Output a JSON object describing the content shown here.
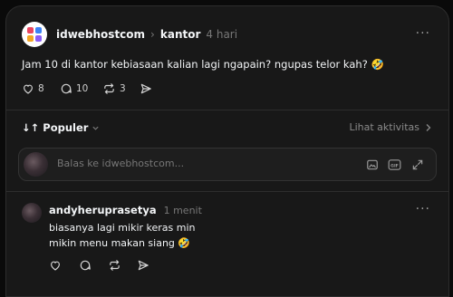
{
  "post": {
    "username": "idwebhostcom",
    "separator": "›",
    "community": "kantor",
    "time": "4 hari",
    "text": "Jam 10 di kantor kebiasaan kalian lagi ngapain? ngupas telor kah? 🤣",
    "likes": "8",
    "comments": "10",
    "reposts": "3",
    "more": "···"
  },
  "sort": {
    "label": "Populer",
    "activity_link": "Lihat aktivitas"
  },
  "reply_box": {
    "placeholder": "Balas ke idwebhostcom..."
  },
  "reply": {
    "username": "andyheruprasetya",
    "time": "1 menit",
    "line1": "biasanya lagi mikir keras min",
    "line2": "mikin menu makan siang 🤣",
    "more": "···"
  },
  "colors": {
    "background": "#181818",
    "text": "#f3f5f7",
    "muted": "#777777"
  }
}
